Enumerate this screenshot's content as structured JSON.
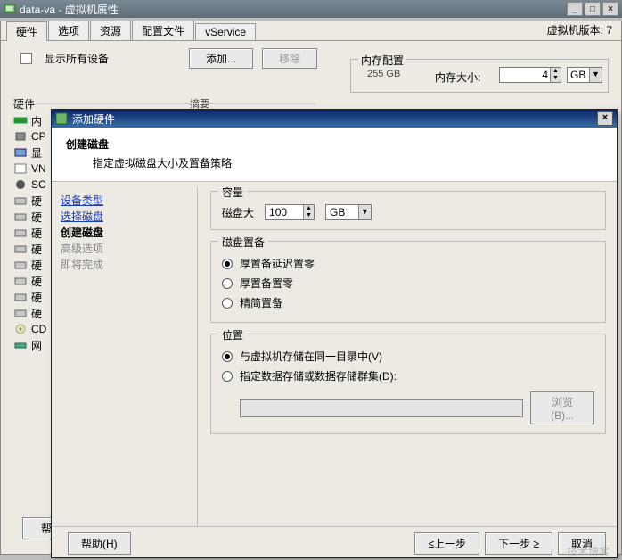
{
  "window": {
    "title": "data-va - 虚拟机属性",
    "version_label": "虚拟机版本: 7"
  },
  "tabs": [
    "硬件",
    "选项",
    "资源",
    "配置文件",
    "vService"
  ],
  "toolbar": {
    "show_all_label": "显示所有设备",
    "add_btn": "添加...",
    "remove_btn": "移除"
  },
  "memory_group": {
    "legend": "内存配置",
    "max": "255 GB",
    "label": "内存大小:",
    "value": "4",
    "unit": "GB"
  },
  "hw_header": "硬件",
  "hw_summary_header": "摘要",
  "hw_items": [
    {
      "label": "内"
    },
    {
      "label": "CP"
    },
    {
      "label": "显"
    },
    {
      "label": "VN"
    },
    {
      "label": "SC"
    },
    {
      "label": "硬"
    },
    {
      "label": "硬"
    },
    {
      "label": "硬"
    },
    {
      "label": "硬"
    },
    {
      "label": "硬"
    },
    {
      "label": "硬"
    },
    {
      "label": "硬"
    },
    {
      "label": "硬"
    },
    {
      "label": "CD"
    },
    {
      "label": "网"
    }
  ],
  "help_btn": "帮助(H)",
  "dialog": {
    "title": "添加硬件",
    "header": "创建磁盘",
    "subheader": "指定虚拟磁盘大小及置备策略",
    "nav": {
      "device_type": "设备类型",
      "select_disk": "选择磁盘",
      "create_disk": "创建磁盘",
      "advanced": "高级选项",
      "finish": "即将完成"
    },
    "capacity": {
      "legend": "容量",
      "label": "磁盘大",
      "value": "100",
      "unit": "GB"
    },
    "provision": {
      "legend": "磁盘置备",
      "opt1": "厚置备延迟置零",
      "opt2": "厚置备置零",
      "opt3": "精简置备"
    },
    "location": {
      "legend": "位置",
      "opt1": "与虚拟机存储在同一目录中(V)",
      "opt2": "指定数据存储或数据存储群集(D):",
      "browse": "浏览(B)..."
    },
    "footer": {
      "help": "帮助(H)",
      "back": "≤上一步",
      "next": "下一步 ≥",
      "cancel": "取消"
    }
  },
  "watermark": {
    "l1": "",
    "l2": "技术博客"
  }
}
